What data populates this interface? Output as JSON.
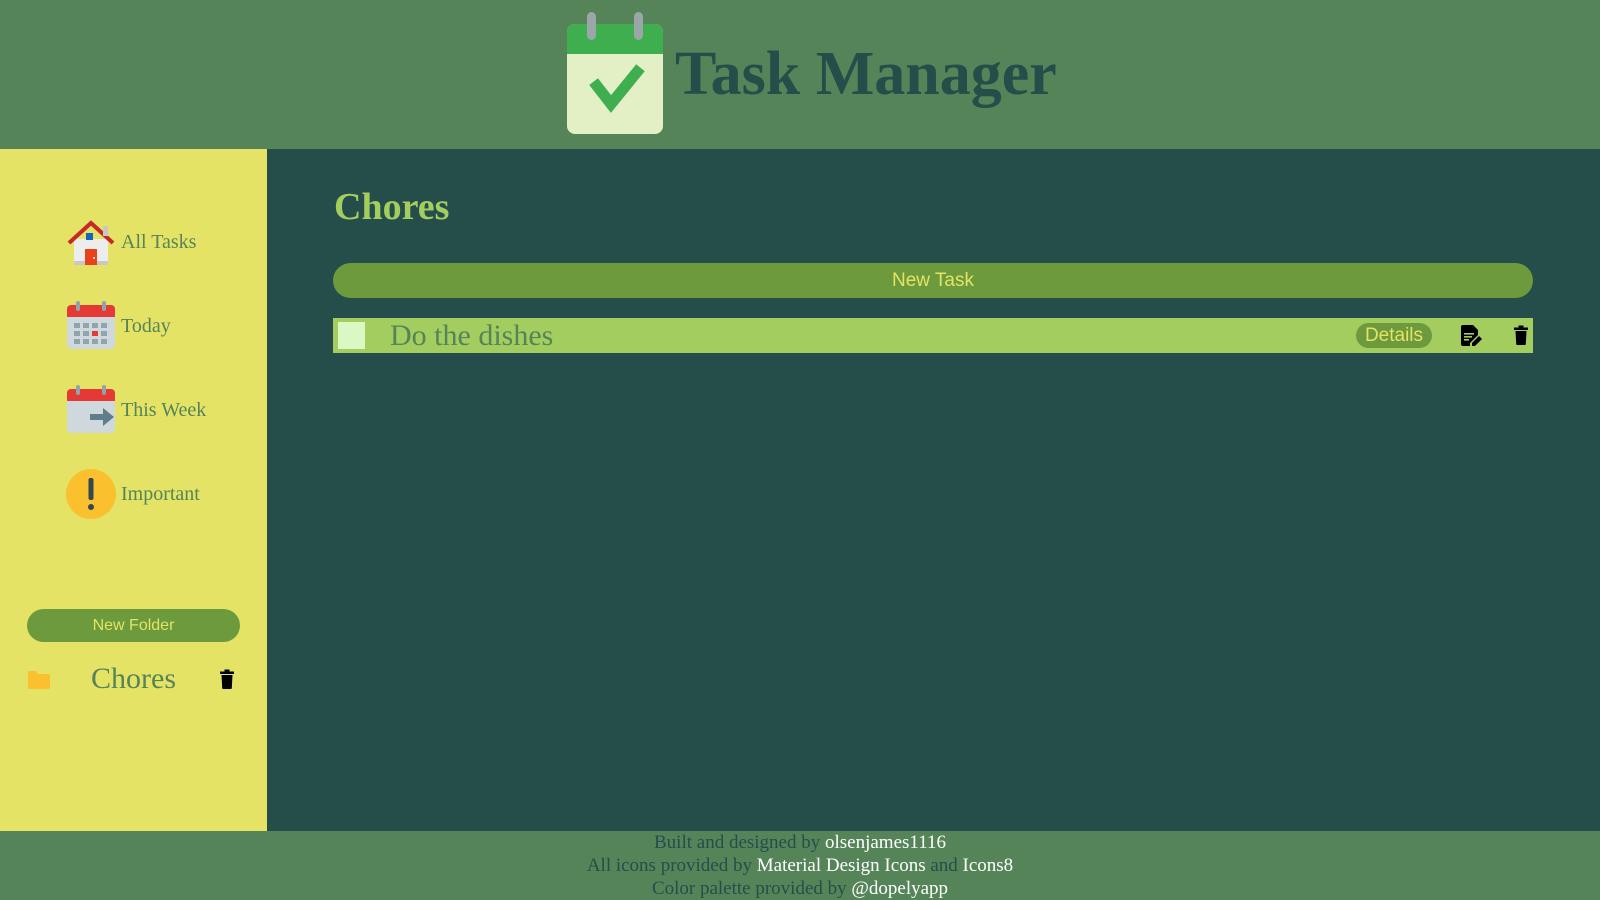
{
  "header": {
    "title": "Task Manager",
    "logo_icon": "calendar-check-icon"
  },
  "sidebar": {
    "items": [
      {
        "label": "All Tasks",
        "icon": "house-icon"
      },
      {
        "label": "Today",
        "icon": "calendar-today-icon"
      },
      {
        "label": "This Week",
        "icon": "calendar-week-icon"
      },
      {
        "label": "Important",
        "icon": "exclamation-icon"
      }
    ],
    "new_folder_label": "New Folder",
    "folders": [
      {
        "name": "Chores",
        "icon": "folder-icon"
      }
    ]
  },
  "main": {
    "title": "Chores",
    "new_task_label": "New Task",
    "tasks": [
      {
        "title": "Do the dishes",
        "checked": false,
        "details_label": "Details"
      }
    ]
  },
  "footer": {
    "line1_text": "Built and designed by ",
    "line1_link": "olsenjames1116",
    "line2_text": "All icons provided by ",
    "line2_link1": "Material Design Icons",
    "line2_and": " and ",
    "line2_link2": "Icons8",
    "line3_text": "Color palette provided by ",
    "line3_link": "@dopelyapp"
  },
  "colors": {
    "header_bg": "#558459",
    "sidebar_bg": "#e4e365",
    "main_bg": "#254e4b",
    "accent_green": "#6d9a3c",
    "task_row_bg": "#a4cd5f",
    "title_text": "#254e4b"
  }
}
